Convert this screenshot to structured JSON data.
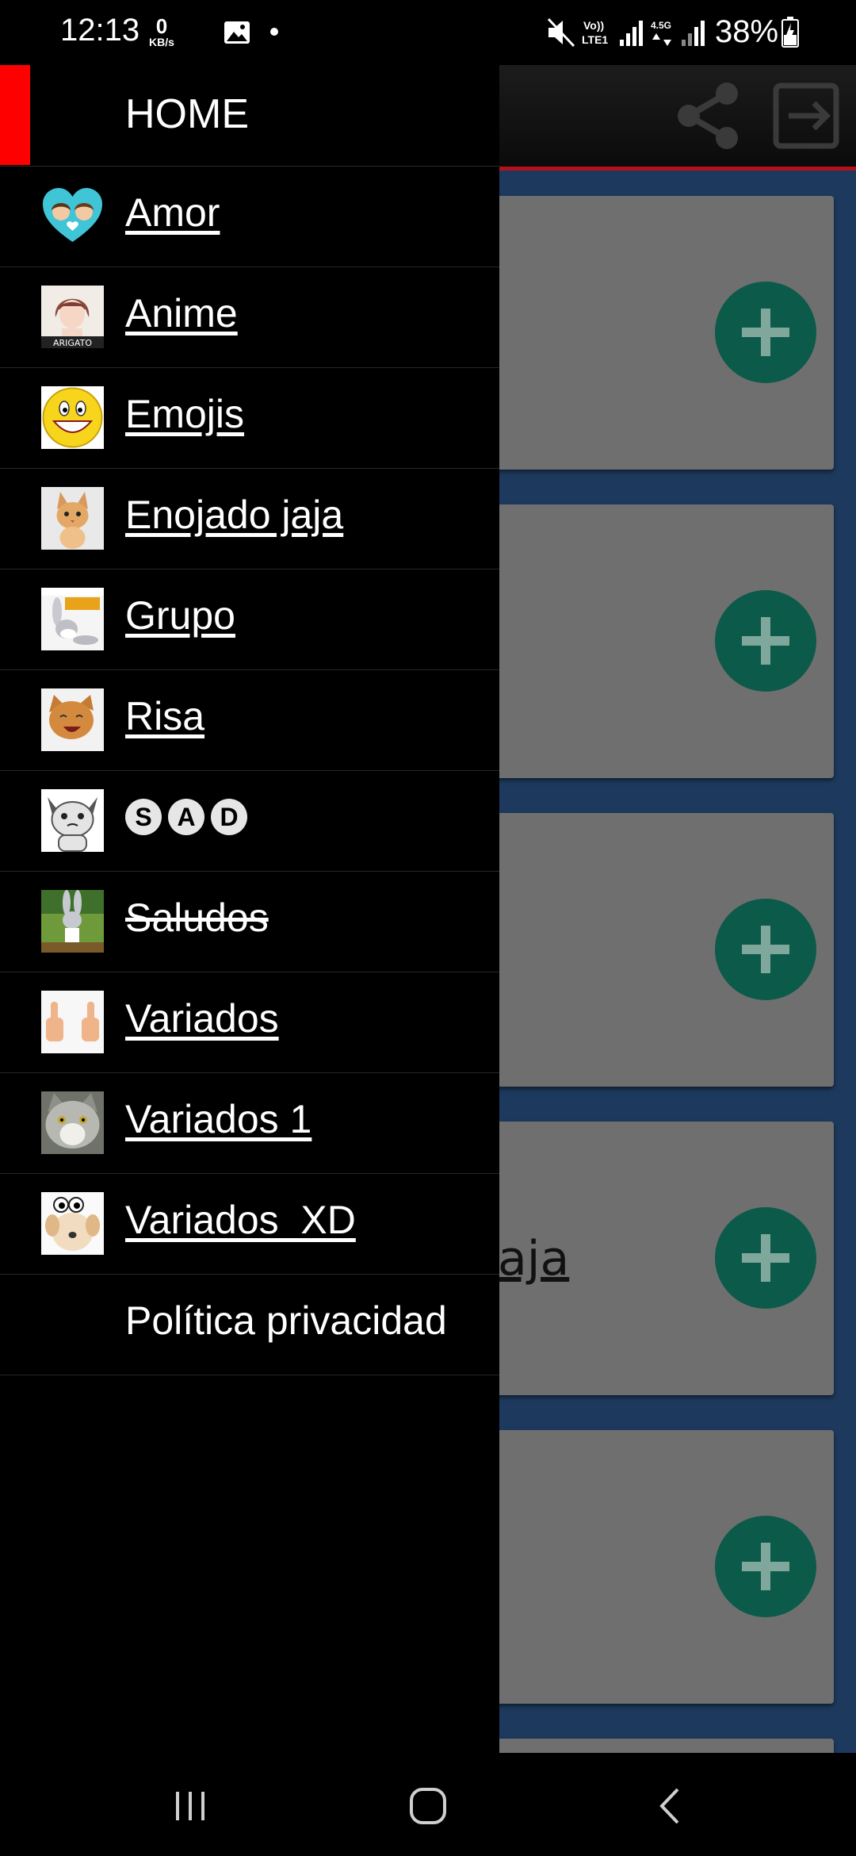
{
  "status_bar": {
    "time": "12:13",
    "net_speed_value": "0",
    "net_speed_unit": "KB/s",
    "battery": "38%",
    "icons": [
      "gallery-icon",
      "dot-icon",
      "mute-icon",
      "volte-icon",
      "signal-icon",
      "signal-icon",
      "battery-charging-icon"
    ]
  },
  "toolbar": {
    "icons": [
      "share-icon",
      "exit-icon"
    ]
  },
  "content_cards": [
    {
      "title": ""
    },
    {
      "title": ""
    },
    {
      "title": ""
    },
    {
      "title": "aja"
    },
    {
      "title": ""
    }
  ],
  "drawer": {
    "header_label": "HOME",
    "accent_color": "#ff0000",
    "items": [
      {
        "label": "Amor",
        "icon": "hearts-couple-icon"
      },
      {
        "label": "Anime",
        "icon": "anime-girl-thumbnail"
      },
      {
        "label": "Emojis",
        "icon": "smiley-emoji-icon"
      },
      {
        "label": "Enojado jaja",
        "icon": "kitten-thumbnail"
      },
      {
        "label": "Grupo",
        "icon": "bugs-bunny-thumbnail"
      },
      {
        "label": "Risa",
        "icon": "laughing-cat-thumbnail"
      },
      {
        "label": "SAD",
        "letters": [
          "S",
          "A",
          "D"
        ],
        "icon": "sad-pikachu-thumbnail"
      },
      {
        "label": "Saludos",
        "icon": "bugs-bunny-greeting-thumbnail"
      },
      {
        "label": "Variados",
        "icon": "thumbs-up-thumbnail"
      },
      {
        "label": "Variados 1",
        "icon": "grumpy-cat-thumbnail"
      },
      {
        "label": "Variados  XD",
        "icon": "puppy-thumbnail"
      },
      {
        "label": "Política privacidad",
        "icon": ""
      }
    ]
  },
  "nav_bar": {
    "buttons": [
      "recents-button",
      "home-button",
      "back-button"
    ]
  }
}
